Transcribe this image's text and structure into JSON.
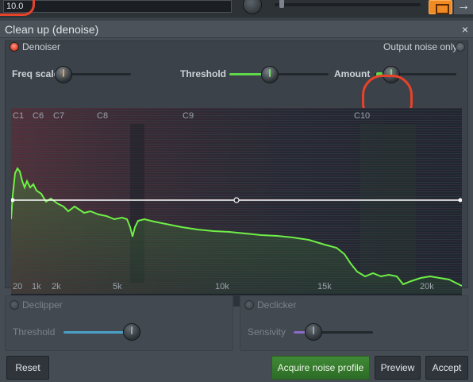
{
  "topbar": {
    "value": "10.0"
  },
  "window": {
    "title": "Clean up (denoise)",
    "close_label": "×"
  },
  "denoiser": {
    "section_label": "Denoiser",
    "output_noise_only_label": "Output noise only",
    "freq_scale_label": "Freq scale",
    "threshold_label": "Threshold",
    "amount_label": "Amount",
    "threshold_level": 0.35,
    "amount_level": 0.08
  },
  "spectrum": {
    "note_labels": [
      "C1",
      "C6",
      "C7",
      "C8",
      "C9",
      "C10"
    ],
    "freq_labels": [
      "20",
      "1k",
      "2k",
      "5k",
      "10k",
      "15k",
      "20k"
    ]
  },
  "declipper": {
    "label": "Declipper",
    "threshold_label": "Threshold"
  },
  "declicker": {
    "label": "Declicker",
    "sensivity_label": "Sensivity"
  },
  "buttons": {
    "reset": "Reset",
    "acquire": "Acquire noise profile",
    "preview": "Preview",
    "accept": "Accept"
  },
  "colors": {
    "accent_green": "#5fd84a",
    "led_red": "#e0442f",
    "annotation_red": "#e8432a"
  }
}
